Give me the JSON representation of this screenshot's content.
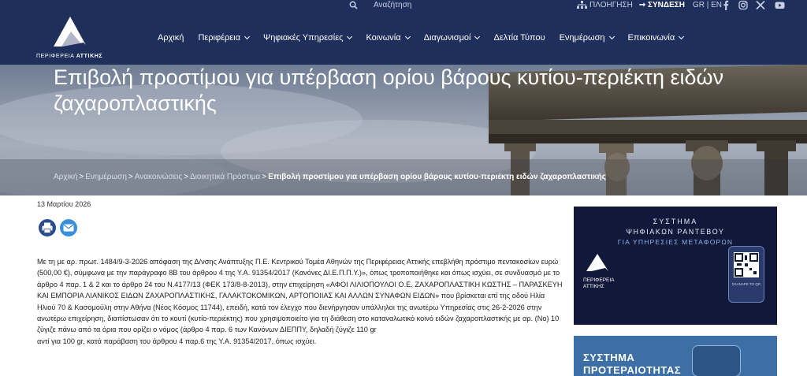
{
  "topbar": {
    "search_label": "Αναζήτηση",
    "nav_label": "ΠΛΟΗΓΗΣΗ",
    "login_label": "ΣΥΝΔΕΣΗ",
    "lang_label": "GR | EN"
  },
  "logo": {
    "name_part1": "ΠΕΡΙΦΕΡΕΙΑ ",
    "name_part2": "ΑΤΤΙΚΗΣ"
  },
  "nav": {
    "items": [
      {
        "label": "Αρχική",
        "has_dropdown": false
      },
      {
        "label": "Περιφέρεια",
        "has_dropdown": true
      },
      {
        "label": "Ψηφιακές Υπηρεσίες",
        "has_dropdown": true
      },
      {
        "label": "Κοινωνία",
        "has_dropdown": true
      },
      {
        "label": "Διαγωνισμοί",
        "has_dropdown": true
      },
      {
        "label": "Δελτία Τύπου",
        "has_dropdown": false
      },
      {
        "label": "Ενημέρωση",
        "has_dropdown": true
      },
      {
        "label": "Επικοινωνία",
        "has_dropdown": true
      }
    ]
  },
  "hero": {
    "title": "Επιβολή προστίμου για υπέρβαση ορίου βάρους κυτίου-περιέκτη ειδών ζαχαροπλαστικής",
    "breadcrumb": [
      "Αρχική",
      "Ενημέρωση",
      "Ανακοινώσεις",
      "Διοικητικά Πρόστιμα",
      "Επιβολή προστίμου για υπέρβαση ορίου βάρους κυτίου-περιέκτη ειδών ζαχαροπλαστικής"
    ]
  },
  "article": {
    "date": "13 Μαρτίου 2026",
    "paragraphs": [
      "Με τη με αρ. πρωτ. 1484/9-3-2026  απόφαση της Δ/νσης Ανάπτυξης Π.Ε. Κεντρικού Τομέα Αθηνών της Περιφέρειας Αττικής επεβλήθη  πρόστιμο πεντακοσίων ευρώ  (500,00  €), σύμφωνα με την παράγραφο  8Β του άρθρου 4  της Υ.Α. 91354/2017  (Κανόνες ΔΙ.Ε.Π.Π.Υ.)», όπως τροποποιήθηκε  και όπως ισχύει,  σε συνδυασμό  με το  άρθρο  4  παρ. 1 & 2  και  το άρθρο 24 του Ν.4177/13 (ΦΕΚ 173/8-8-2013), στην επιχείρηση «ΑΦΟΙ ΛΙΛΙΟΠΟΥΛΟΙ Ο.Ε. ΖΑΧΑΡΟΠΛΑΣΤΙΚΗ  ΚΩΣΤΗΣ – ΠΑΡΑΣΚΕΥΗ  ΚΑΙ  ΕΜΠΟΡΙΑ ΛΙΑΝΙΚΟΣ ΕΙΔΩΝ ΖΑΧΑΡΟΠΛΑΣΤΙΚΗΣ, ΓΑΛΑΚΤΟΚΟΜΙΚΩΝ, ΑΡΤΟΠΟΙΙΑΣ ΚΑΙ ΑΛΛΩΝ ΣΥΝΑΦΩΝ ΕΙΔΩΝ» που βρίσκεται επί της οδού Ηλία Ηλιού 70 & Κασομούλη  στην Αθήνα (Νέος Κόσμος 11744), επειδή, κατά τον έλεγχο που διενήργησαν υπάλληλοι της ανωτέρω Υπηρεσίας στις 26-2-2026 στην ανωτέρω επιχείρηση, διαπίστωσαν ότι  το κουτί (κυτίο-περιέκτης) που χρησιμοποιείτο για τη διάθεση στο καταναλωτικό κοινό ειδών ζαχαροπλαστικής με αρ. (Νο) 10 ζύγιζε πάνω από τα όρια που ορίζει ο νόμος  (άρθρο 4 παρ. 6 των Κανόνων ΔΙΕΠΠΥ,  δηλαδή ζύγιζε 110 gr",
      "αντί για 100 gr, κατά  παράβαση του  άρθρου 4 παρ.6 της  Υ.Α. 91354/2017,  όπως ισχύει."
    ]
  },
  "banner1": {
    "line1": "ΣΥΣΤΗΜΑ",
    "line2": "ΨΗΦΙΑΚΩΝ ΡΑΝΤΕΒΟΥ",
    "line3": "ΓΙΑ ΥΠΗΡΕΣΙΕΣ ΜΕΤΑΦΟΡΩΝ",
    "logo_line1": "ΠΕΡΙΦΕΡΕΙΑ",
    "logo_line2": "ΑΤΤΙΚΗΣ",
    "scan_label": "ΣΚΑΝΑΡΕ ΤΟ QR"
  },
  "banner2": {
    "line1": "ΣΥΣΤΗΜΑ",
    "line2": "ΠΡΟΤΕΡΑΙΟΤΗΤΑΣ"
  },
  "colors": {
    "header_bg": "#1f2f5c",
    "banner1_bg": "#11193a",
    "banner2_bg": "#3c6fa6",
    "print_icon": "#2b4b8c",
    "mail_icon": "#3a8fd9"
  },
  "icons": [
    "search-icon",
    "sitemap-icon",
    "login-arrow-icon",
    "facebook-icon",
    "instagram-icon",
    "x-icon",
    "youtube-icon",
    "print-icon",
    "mail-icon",
    "qr-code-icon"
  ]
}
